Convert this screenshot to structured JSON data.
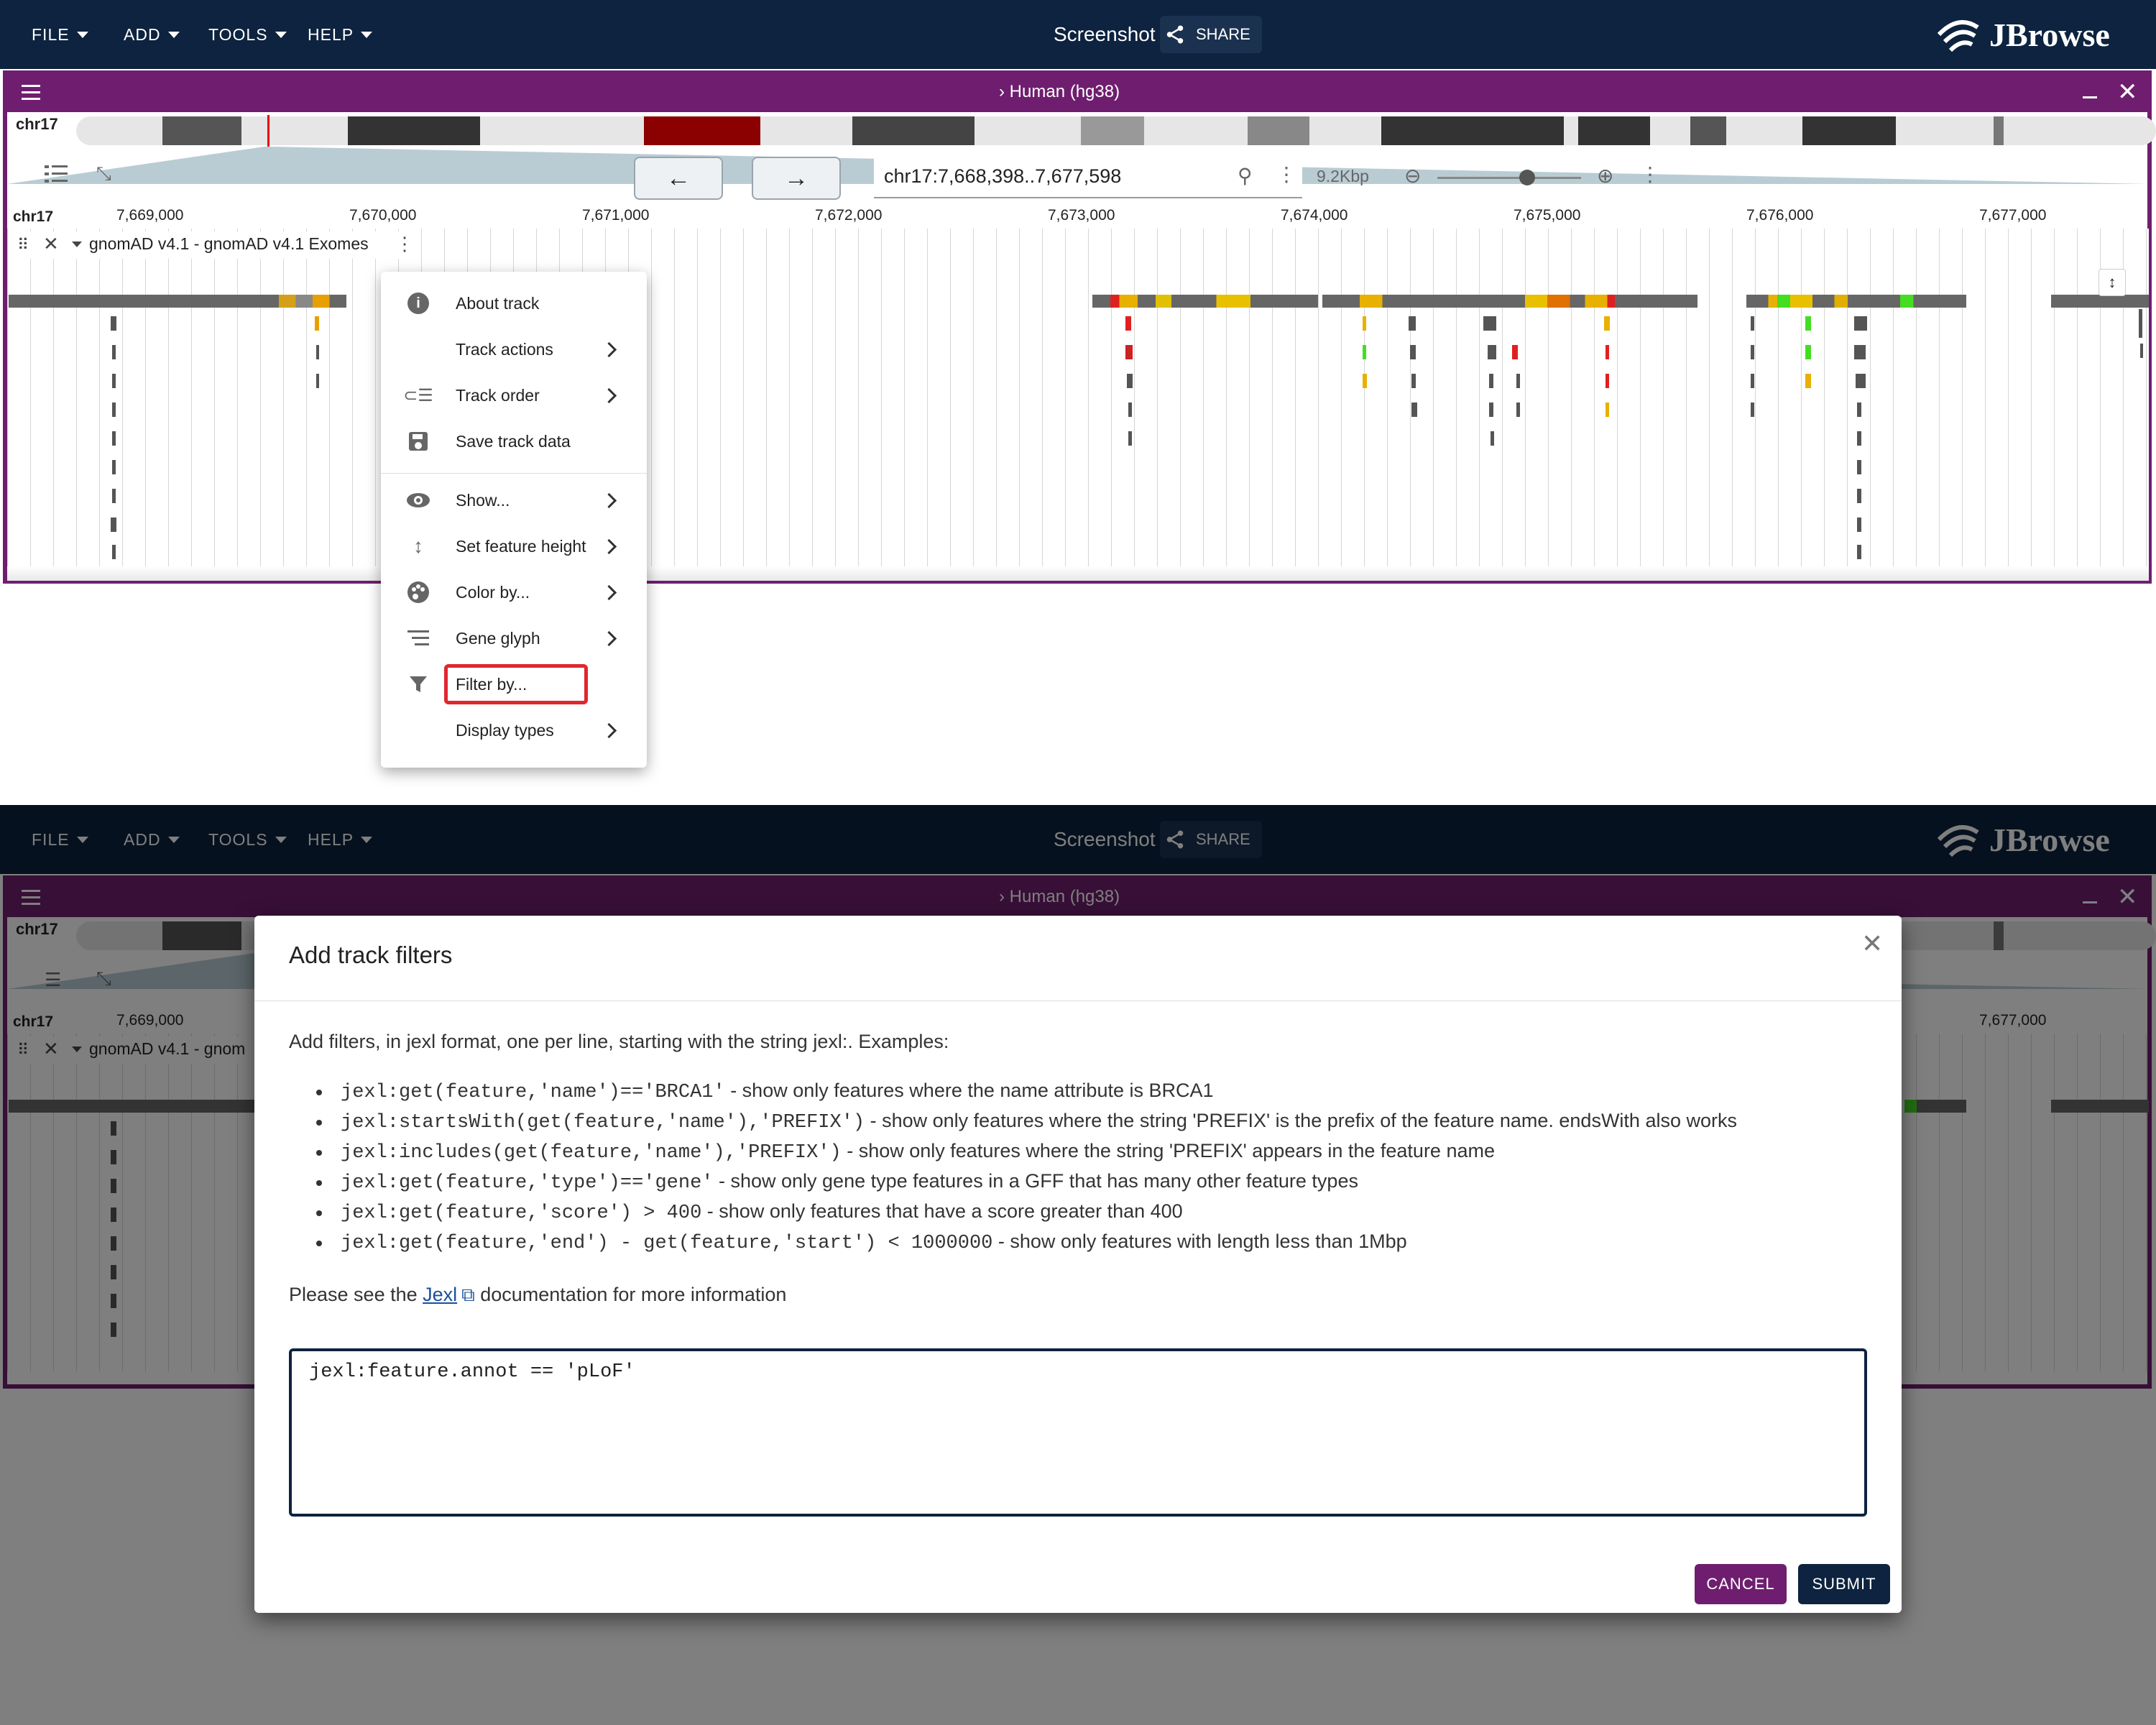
{
  "appbar": {
    "menus": [
      "FILE",
      "ADD",
      "TOOLS",
      "HELP"
    ],
    "session_title": "Screenshot",
    "share_label": "SHARE",
    "logo_text": "JBrowse"
  },
  "view": {
    "assembly_label": "Human (hg38)",
    "chromosome": "chr17",
    "location": "chr17:7,668,398..7,677,598",
    "bp_per_view": "9.2Kbp",
    "ruler_ticks": [
      "7,669,000",
      "7,670,000",
      "7,671,000",
      "7,672,000",
      "7,673,000",
      "7,674,000",
      "7,675,000",
      "7,676,000",
      "7,677,000"
    ],
    "track_label": "gnomAD v4.1 - gnomAD v4.1 Exomes",
    "track_label_short": "gnomAD v4.1 - gnom"
  },
  "track_menu": {
    "items": [
      {
        "label": "About track",
        "icon": "info-icon",
        "submenu": false
      },
      {
        "label": "Track actions",
        "icon": "",
        "submenu": true
      },
      {
        "label": "Track order",
        "icon": "track-order-icon",
        "submenu": true
      },
      {
        "label": "Save track data",
        "icon": "save-icon",
        "submenu": false
      },
      {
        "label": "Show...",
        "icon": "eye-icon",
        "submenu": true
      },
      {
        "label": "Set feature height",
        "icon": "vertical-arrows-icon",
        "submenu": true
      },
      {
        "label": "Color by...",
        "icon": "palette-icon",
        "submenu": true
      },
      {
        "label": "Gene glyph",
        "icon": "gene-glyph-icon",
        "submenu": true
      },
      {
        "label": "Filter by...",
        "icon": "filter-icon",
        "submenu": false
      },
      {
        "label": "Display types",
        "icon": "",
        "submenu": true
      }
    ],
    "highlight_color": "#e0262e"
  },
  "dialog": {
    "title": "Add track filters",
    "intro": "Add filters, in jexl format, one per line, starting with the string jexl:. Examples:",
    "examples": [
      {
        "code": "jexl:get(feature,'name')=='BRCA1'",
        "desc": " - show only features where the name attribute is BRCA1"
      },
      {
        "code": "jexl:startsWith(get(feature,'name'),'PREFIX')",
        "desc": " - show only features where the string 'PREFIX' is the prefix of the feature name. endsWith also works"
      },
      {
        "code": "jexl:includes(get(feature,'name'),'PREFIX')",
        "desc": " - show only features where the string 'PREFIX' appears in the feature name"
      },
      {
        "code": "jexl:get(feature,'type')=='gene'",
        "desc": " - show only gene type features in a GFF that has many other feature types"
      },
      {
        "code": "jexl:get(feature,'score') > 400",
        "desc": " - show only features that have a score greater than 400"
      },
      {
        "code": "jexl:get(feature,'end') - get(feature,'start') < 1000000",
        "desc": " - show only features with length less than 1Mbp"
      }
    ],
    "docs_prefix": "Please see the ",
    "docs_link": "Jexl",
    "docs_suffix": " documentation for more information",
    "textarea_value": "jexl:feature.annot == 'pLoF'",
    "cancel_label": "CANCEL",
    "submit_label": "SUBMIT"
  },
  "colors": {
    "appbar": "#0d233f",
    "view_border": "#6f1e6f",
    "cancel_button": "#6f1e6f",
    "submit_button": "#0d233f"
  }
}
